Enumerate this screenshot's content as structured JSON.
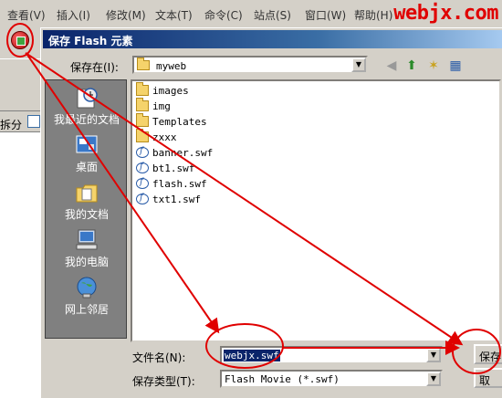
{
  "brand": "webjx.com",
  "app_menu": [
    "查看(V)",
    "插入(I)",
    "修改(M)",
    "文本(T)",
    "命令(C)",
    "站点(S)",
    "窗口(W)",
    "帮助(H)"
  ],
  "left_panel": {
    "split_label": "拆分"
  },
  "dialog": {
    "title": "保存 Flash 元素",
    "save_in": {
      "label": "保存在(I):",
      "value": "myweb"
    },
    "places": [
      {
        "label": "我最近的文档",
        "icon": "recent-documents-icon"
      },
      {
        "label": "桌面",
        "icon": "desktop-icon"
      },
      {
        "label": "我的文档",
        "icon": "my-documents-icon"
      },
      {
        "label": "我的电脑",
        "icon": "my-computer-icon"
      },
      {
        "label": "网上邻居",
        "icon": "network-places-icon"
      }
    ],
    "files": [
      {
        "name": "images",
        "type": "folder"
      },
      {
        "name": "img",
        "type": "folder"
      },
      {
        "name": "Templates",
        "type": "folder"
      },
      {
        "name": "zxxx",
        "type": "folder"
      },
      {
        "name": "banner.swf",
        "type": "swf"
      },
      {
        "name": "bt1.swf",
        "type": "swf"
      },
      {
        "name": "flash.swf",
        "type": "swf"
      },
      {
        "name": "txt1.swf",
        "type": "swf"
      }
    ],
    "file_name": {
      "label": "文件名(N):",
      "value": "webjx.swf"
    },
    "file_type": {
      "label": "保存类型(T):",
      "value": "Flash Movie (*.swf)"
    },
    "save_button": "保存",
    "cancel_button": "取"
  },
  "colors": {
    "annotation": "#e00000",
    "titlebar": "#0a246a",
    "selection": "#0a246a"
  }
}
